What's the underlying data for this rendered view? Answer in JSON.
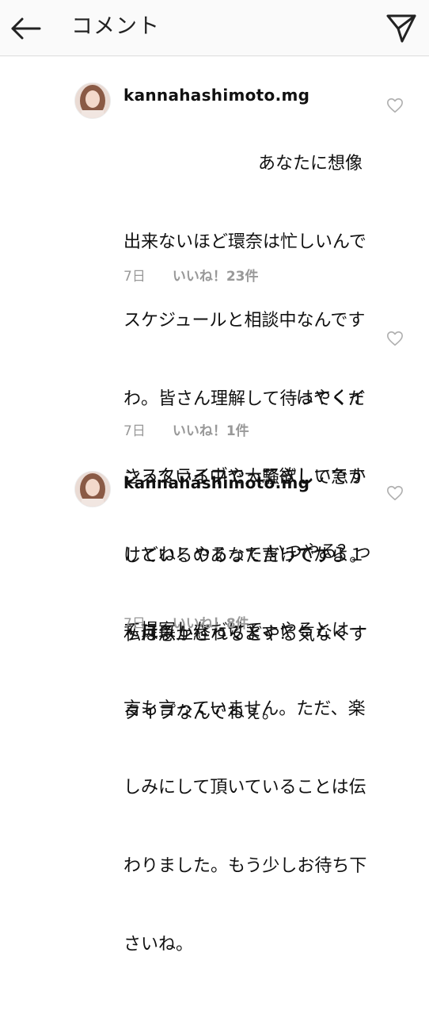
{
  "header": {
    "back_icon": "arrow-left-icon",
    "title": "コメント",
    "send_icon": "paper-plane-icon"
  },
  "comments": [
    {
      "username": "kannahashimoto.mg",
      "lines": [
        "あなたに想像",
        "出来ないほど環奈は忙しいんで",
        "スケジュールと相談中なんです",
        "わ。皆さん理解して待ってくだ",
        "さっている中で大騒ぎして急か",
        "しているのあなただけですよ。",
        "私は急かされるとやる気なくす",
        "タイプなんでねぇ。"
      ],
      "time": "7日",
      "likes": "いいね！23件"
    },
    {
      "username": "",
      "lines": [
        "はやくイ",
        "ンスタライブやって欲しいです",
        "けどね！やるって言ってから１",
        "ヶ月以上経ってます！"
      ],
      "time": "7日",
      "likes": "いいね！1件"
    },
    {
      "username": "kannahashimoto.mg",
      "lines": [
        "いつやる？っ",
        "て提案しただけで、やるとは一",
        "言も言っていません。ただ、楽",
        "しみにして頂いていることは伝",
        "わりました。もう少しお待ち下",
        "さいね。"
      ],
      "time": "7日",
      "likes": "いいね！8件"
    }
  ],
  "colors": {
    "header_bg": "#fafafa",
    "meta_text": "#999999",
    "text": "#111111"
  }
}
